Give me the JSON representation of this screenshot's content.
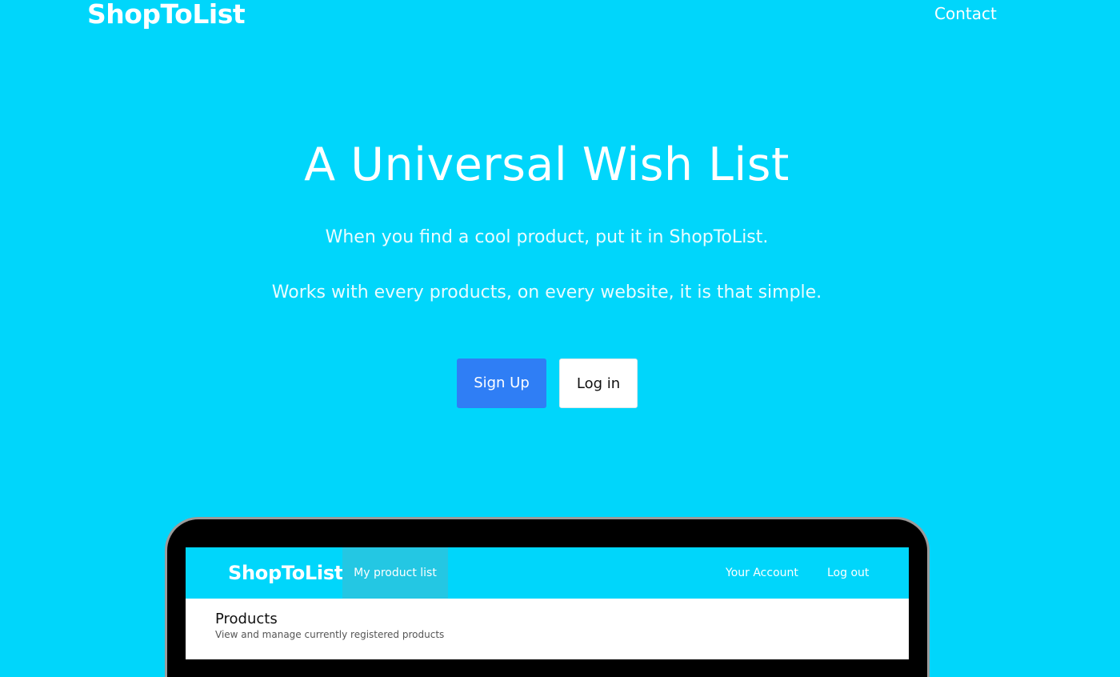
{
  "nav": {
    "brand": "ShopToList",
    "contact": "Contact"
  },
  "hero": {
    "title": "A Universal Wish List",
    "line1": "When you find a cool product, put it in ShopToList.",
    "line2": "Works with every products, on every website, it is that simple.",
    "signup_label": "Sign Up",
    "login_label": "Log in"
  },
  "preview": {
    "brand": "ShopToList",
    "tab_label": "My product list",
    "account_label": "Your Account",
    "logout_label": "Log out",
    "heading": "Products",
    "subheading": "View and manage currently registered products"
  },
  "colors": {
    "background": "#00d6fb",
    "primary_button": "#2f7ef5",
    "secondary_button": "#ffffff"
  }
}
